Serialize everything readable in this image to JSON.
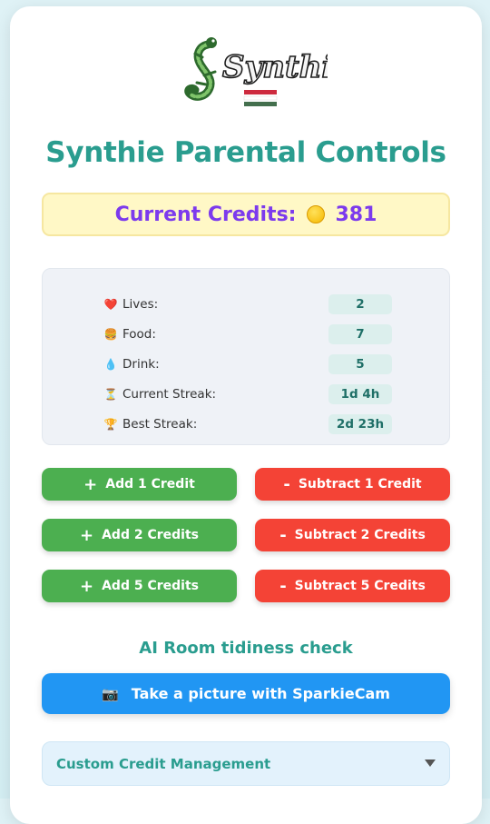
{
  "logo": {
    "text": "Synthie",
    "flag_colors": [
      "#cd2a3e",
      "#ffffff",
      "#436f4d"
    ]
  },
  "header": {
    "title": "Synthie Parental Controls"
  },
  "credits": {
    "label": "Current Credits:",
    "value": "381",
    "icon": "coin-icon"
  },
  "stats": [
    {
      "icon": "❤️",
      "icon_name": "heart-icon",
      "label": "Lives:",
      "value": "2"
    },
    {
      "icon": "🍔",
      "icon_name": "burger-icon",
      "label": "Food:",
      "value": "7"
    },
    {
      "icon": "💧",
      "icon_name": "droplet-icon",
      "label": "Drink:",
      "value": "5"
    },
    {
      "icon": "⏳",
      "icon_name": "hourglass-icon",
      "label": "Current Streak:",
      "value": "1d 4h"
    },
    {
      "icon": "🏆",
      "icon_name": "trophy-icon",
      "label": "Best Streak:",
      "value": "2d 23h"
    }
  ],
  "buttons": {
    "add1": "Add 1 Credit",
    "sub1": "Subtract 1 Credit",
    "add2": "Add 2 Credits",
    "sub2": "Subtract 2 Credits",
    "add5": "Add 5 Credits",
    "sub5": "Subtract 5 Credits",
    "plus": "+",
    "minus": "-"
  },
  "ai": {
    "title": "AI Room tidiness check",
    "camera_label": "Take a picture with SparkieCam",
    "camera_icon": "📷"
  },
  "custom": {
    "label": "Custom Credit Management"
  },
  "colors": {
    "accent": "#2a9d8f",
    "credits": "#7c3aed",
    "green": "#4caf50",
    "red": "#f44336",
    "blue": "#2196f3"
  }
}
